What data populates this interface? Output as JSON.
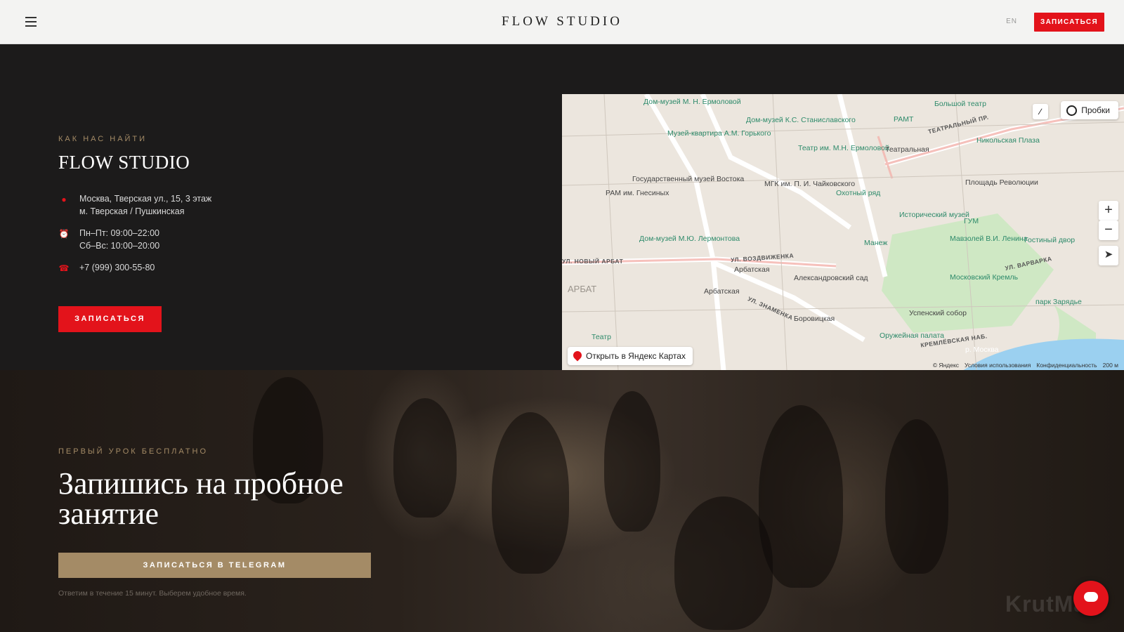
{
  "header": {
    "brand": "FLOW STUDIO",
    "lang": "EN",
    "cta": "ЗАПИСАТЬСЯ",
    "icons": {
      "menu": "hamburger-menu-icon"
    }
  },
  "contacts": {
    "eyebrow": "КАК НАС НАЙТИ",
    "title": "FLOW STUDIO",
    "address_line1": "Москва, Тверская ул., 15, 3 этаж",
    "address_line2": "м. Тверская / Пушкинская",
    "hours_line1": "Пн–Пт: 09:00–22:00",
    "hours_line2": "Сб–Вс: 10:00–20:00",
    "phone": "+7 (999) 300-55-80",
    "cta": "ЗАПИСАТЬСЯ",
    "icons": {
      "address": "location-pin-icon",
      "hours": "alarm-clock-icon",
      "phone": "phone-icon"
    }
  },
  "map": {
    "traffic": "Пробки",
    "open_maps": "Открыть в Яндекс Картах",
    "copyright": "© Яндекс",
    "terms": "Условия использования",
    "privacy": "Конфиденциальность",
    "scale": "200 м",
    "labels": {
      "dom_ermolovoy": "Дом-музей М. Н. Ермоловой",
      "bolshoy": "Большой театр",
      "stanislavsky": "Дом-музей К.С. Станиславского",
      "gorky": "Музей-квартира А.М. Горького",
      "ramt": "РАМТ",
      "ermolovoy_theatre": "Театр им. М.Н. Ермоловой",
      "teatralnaya": "Театральная",
      "nikolskaya": "Никольская Плаза",
      "vostok": "Государственный музей Востока",
      "mgk": "МГК им. П. И. Чайковского",
      "ram": "РАМ им. Гнесиных",
      "okhotny": "Охотный ряд",
      "revolution": "Площадь Революции",
      "historical": "Исторический музей",
      "gum": "ГУМ",
      "lermontov": "Дом-музей М.Ю. Лермонтова",
      "manezh": "Манеж",
      "mausoleum": "Мавзолей В.И. Ленина",
      "gostiny": "Гостиный двор",
      "arbatskaya1": "Арбатская",
      "arbatskaya2": "Арбатская",
      "alexander": "Александровский сад",
      "kremlin": "Московский Кремль",
      "uspensky": "Успенский собор",
      "zaryadye": "парк Зарядье",
      "borovitskaya": "Боровицкая",
      "oruzheynaya": "Оружейная палата",
      "teatr": "Театр",
      "arbat_area": "АРБАТ",
      "moskva_river": "р. Москва"
    },
    "streets": {
      "novy_arbat": "УЛ. НОВЫЙ АРБАТ",
      "vozdvizhenka": "УЛ. ВОЗДВИЖЕНКА",
      "znamenka": "УЛ. ЗНАМЕНКА",
      "teatralny": "ТЕАТРАЛЬНЫЙ ПР.",
      "varvarka": "УЛ. ВАРВАРКА",
      "kremlevskaya": "КРЕМЛЁВСКАЯ НАБ."
    },
    "icons": {
      "traffic": "traffic-icon",
      "ruler": "ruler-icon",
      "zoom_in": "plus-icon",
      "zoom_out": "minus-icon",
      "locate": "location-arrow-icon",
      "pin": "map-pin-icon"
    }
  },
  "hero": {
    "eyebrow": "ПЕРВЫЙ УРОК БЕСПЛАТНО",
    "title": "Запишись на пробное занятие",
    "cta": "ЗАПИСАТЬСЯ В TELEGRAM",
    "note": "Ответим в течение 15 минут. Выберем удобное время.",
    "watermark": "KrutMax",
    "icons": {
      "chat": "chat-bubble-icon"
    }
  },
  "colors": {
    "accent_red": "#e3131b",
    "gold": "#a48b66",
    "dark_bg": "#1c1b1b",
    "header_bg": "#f3f3f2"
  }
}
